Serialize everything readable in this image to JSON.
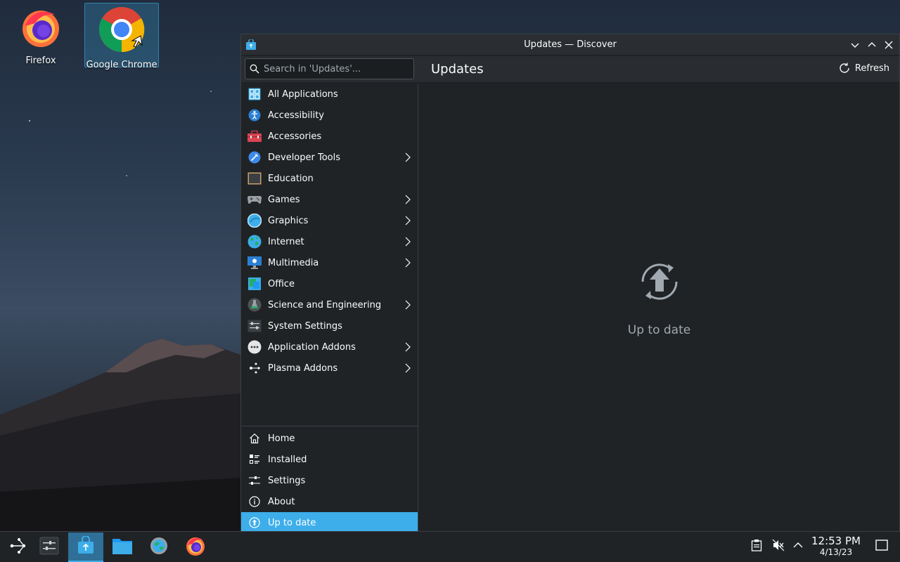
{
  "desktop": {
    "icons": [
      {
        "label": "Firefox",
        "icon": "firefox-icon"
      },
      {
        "label": "Google Chrome",
        "icon": "chrome-icon"
      }
    ]
  },
  "window": {
    "title": "Updates — Discover",
    "search_placeholder": "Search in 'Updates'...",
    "page_title": "Updates",
    "refresh_label": "Refresh"
  },
  "sidebar": {
    "categories": [
      {
        "label": "All Applications",
        "icon": "grid-icon",
        "has_submenu": false
      },
      {
        "label": "Accessibility",
        "icon": "accessibility-icon",
        "has_submenu": false
      },
      {
        "label": "Accessories",
        "icon": "toolbox-icon",
        "has_submenu": false
      },
      {
        "label": "Developer Tools",
        "icon": "developer-tools-icon",
        "has_submenu": true
      },
      {
        "label": "Education",
        "icon": "chalkboard-icon",
        "has_submenu": false
      },
      {
        "label": "Games",
        "icon": "gamepad-icon",
        "has_submenu": true
      },
      {
        "label": "Graphics",
        "icon": "graphics-icon",
        "has_submenu": true
      },
      {
        "label": "Internet",
        "icon": "globe-icon",
        "has_submenu": true
      },
      {
        "label": "Multimedia",
        "icon": "multimedia-icon",
        "has_submenu": true
      },
      {
        "label": "Office",
        "icon": "office-icon",
        "has_submenu": false
      },
      {
        "label": "Science and Engineering",
        "icon": "flask-icon",
        "has_submenu": true
      },
      {
        "label": "System Settings",
        "icon": "system-settings-icon",
        "has_submenu": false
      },
      {
        "label": "Application Addons",
        "icon": "addons-icon",
        "has_submenu": true
      },
      {
        "label": "Plasma Addons",
        "icon": "plasma-icon",
        "has_submenu": true
      }
    ],
    "nav": [
      {
        "label": "Home",
        "icon": "home-icon"
      },
      {
        "label": "Installed",
        "icon": "installed-icon"
      },
      {
        "label": "Settings",
        "icon": "settings-sliders-icon"
      },
      {
        "label": "About",
        "icon": "info-icon"
      },
      {
        "label": "Up to date",
        "icon": "update-status-icon"
      }
    ]
  },
  "main": {
    "status_text": "Up to date",
    "status_icon": "update-arrow-icon"
  },
  "taskbar": {
    "time": "12:53 PM",
    "date": "4/13/23",
    "apps": [
      "application-launcher-icon",
      "task-settings-icon",
      "discover-icon",
      "file-manager-icon",
      "system-settings-icon",
      "firefox-icon"
    ],
    "tray": [
      "clipboard-icon",
      "volume-muted-icon",
      "expand-tray-icon",
      "show-desktop-icon"
    ]
  },
  "colors": {
    "accent": "#3daee9",
    "window_bg": "#202326",
    "text": "#fcfcfc",
    "muted_text": "#a1a9b1"
  }
}
